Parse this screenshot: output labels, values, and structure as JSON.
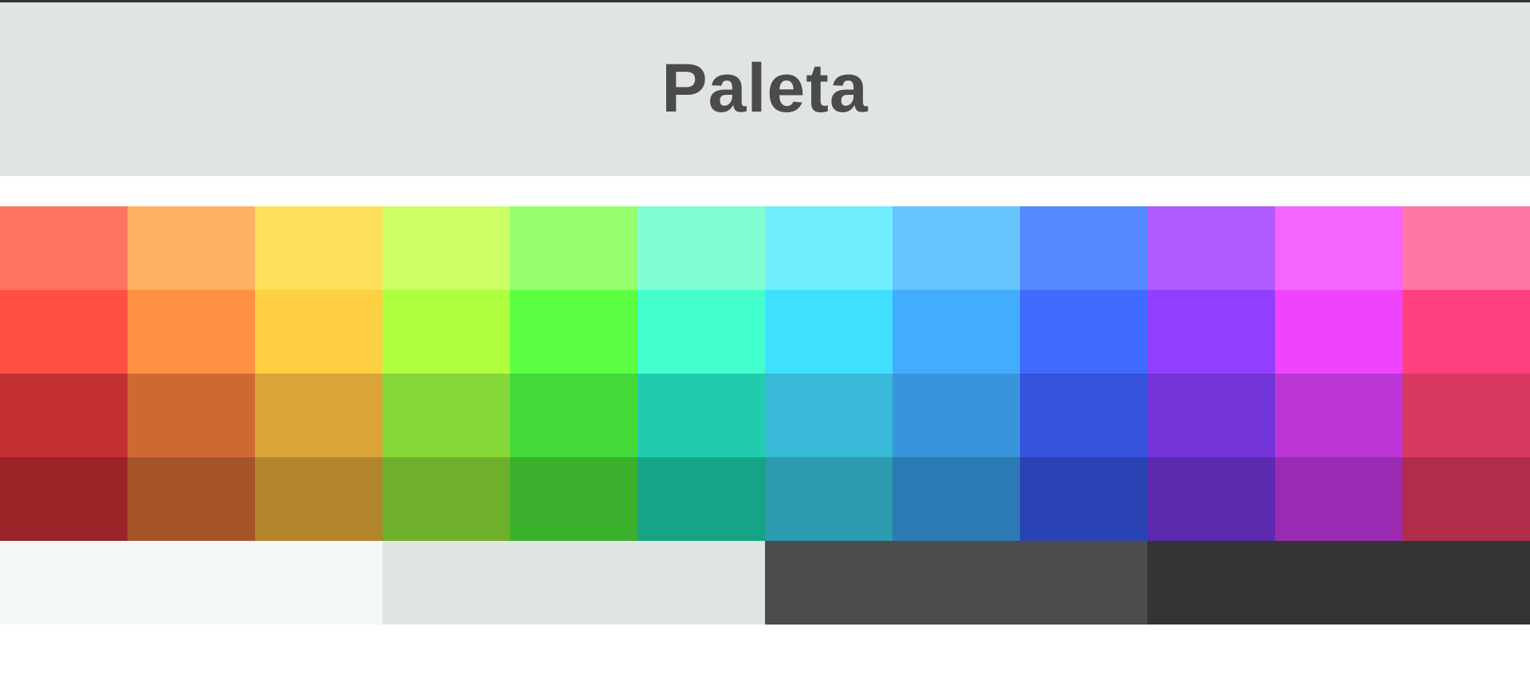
{
  "header": {
    "title": "Paleta",
    "background": "#e0e4e4",
    "text_color": "#4b4b4d"
  },
  "palette": {
    "hues": [
      "red",
      "orange",
      "yellow",
      "lime",
      "green",
      "mint",
      "cyan",
      "sky",
      "blue",
      "purple",
      "magenta",
      "pink"
    ],
    "rows": [
      [
        "#ff7562",
        "#ffb064",
        "#ffe05a",
        "#ccff66",
        "#96ff6e",
        "#80ffd2",
        "#72eeff",
        "#66c4ff",
        "#5588ff",
        "#b05bff",
        "#f664ff",
        "#ff76a6"
      ],
      [
        "#ff5043",
        "#ff8f42",
        "#ffcf42",
        "#afff40",
        "#5dff42",
        "#42ffcc",
        "#40deff",
        "#42adff",
        "#3f6cff",
        "#913ffe",
        "#f043fe",
        "#ff407e"
      ],
      [
        "#c12f32",
        "#cd6a33",
        "#dba438",
        "#85d838",
        "#43d938",
        "#22cbaf",
        "#38b9d7",
        "#3895db",
        "#3552db",
        "#7234d6",
        "#bb35d7",
        "#d9385e"
      ],
      [
        "#9a2427",
        "#a55329",
        "#b3852a",
        "#6eaf2c",
        "#3bb02c",
        "#15a485",
        "#2c9aaf",
        "#2b7ab4",
        "#2a43b4",
        "#5b2aaf",
        "#9b2ab2",
        "#b12b4a"
      ]
    ],
    "grays": [
      "#f4f7f8",
      "#e0e4e4",
      "#4b4c4e",
      "#333433"
    ]
  }
}
